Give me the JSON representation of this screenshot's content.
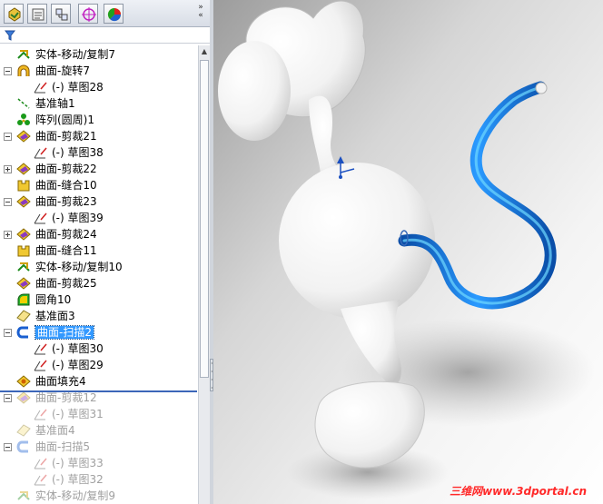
{
  "toolbar": {
    "buttons": [
      "feature-manager-icon",
      "property-manager-icon",
      "configuration-manager-icon",
      "dimxpert-icon",
      "display-manager-icon"
    ]
  },
  "tree": {
    "items": [
      {
        "label": "实体-移动/复制7",
        "icon": "move-copy-icon",
        "indent": 1,
        "expander": "none",
        "state": "normal"
      },
      {
        "label": "曲面-旋转7",
        "icon": "surface-revolve-icon",
        "indent": 1,
        "expander": "minus",
        "state": "normal"
      },
      {
        "label": "(-) 草图28",
        "icon": "sketch-icon",
        "indent": 2,
        "expander": "none",
        "state": "normal"
      },
      {
        "label": "基准轴1",
        "icon": "axis-icon",
        "indent": 1,
        "expander": "none",
        "state": "normal"
      },
      {
        "label": "阵列(圆周)1",
        "icon": "circular-pattern-icon",
        "indent": 1,
        "expander": "none",
        "state": "normal"
      },
      {
        "label": "曲面-剪裁21",
        "icon": "surface-trim-icon",
        "indent": 1,
        "expander": "minus",
        "state": "normal"
      },
      {
        "label": "(-) 草图38",
        "icon": "sketch-icon",
        "indent": 2,
        "expander": "none",
        "state": "normal"
      },
      {
        "label": "曲面-剪裁22",
        "icon": "surface-trim-icon",
        "indent": 1,
        "expander": "plus",
        "state": "normal"
      },
      {
        "label": "曲面-缝合10",
        "icon": "surface-knit-icon",
        "indent": 1,
        "expander": "none",
        "state": "normal"
      },
      {
        "label": "曲面-剪裁23",
        "icon": "surface-trim-icon",
        "indent": 1,
        "expander": "minus",
        "state": "normal"
      },
      {
        "label": "(-) 草图39",
        "icon": "sketch-icon",
        "indent": 2,
        "expander": "none",
        "state": "normal"
      },
      {
        "label": "曲面-剪裁24",
        "icon": "surface-trim-icon",
        "indent": 1,
        "expander": "plus",
        "state": "normal"
      },
      {
        "label": "曲面-缝合11",
        "icon": "surface-knit-icon",
        "indent": 1,
        "expander": "none",
        "state": "normal"
      },
      {
        "label": "实体-移动/复制10",
        "icon": "move-copy-icon",
        "indent": 1,
        "expander": "none",
        "state": "normal"
      },
      {
        "label": "曲面-剪裁25",
        "icon": "surface-trim-icon",
        "indent": 1,
        "expander": "none",
        "state": "normal"
      },
      {
        "label": "圆角10",
        "icon": "fillet-icon",
        "indent": 1,
        "expander": "none",
        "state": "normal"
      },
      {
        "label": "基准面3",
        "icon": "plane-icon",
        "indent": 1,
        "expander": "none",
        "state": "normal"
      },
      {
        "label": "曲面-扫描2",
        "icon": "surface-sweep-icon",
        "indent": 1,
        "expander": "minus",
        "state": "selected"
      },
      {
        "label": "(-) 草图30",
        "icon": "sketch-icon",
        "indent": 2,
        "expander": "none",
        "state": "normal"
      },
      {
        "label": "(-) 草图29",
        "icon": "sketch-icon",
        "indent": 2,
        "expander": "none",
        "state": "normal"
      },
      {
        "label": "曲面填充4",
        "icon": "surface-fill-icon",
        "indent": 1,
        "expander": "none",
        "state": "normal"
      },
      {
        "label": "曲面-剪裁12",
        "icon": "surface-trim-icon",
        "indent": 1,
        "expander": "minus",
        "state": "suppressed"
      },
      {
        "label": "(-) 草图31",
        "icon": "sketch-icon",
        "indent": 2,
        "expander": "none",
        "state": "suppressed"
      },
      {
        "label": "基准面4",
        "icon": "plane-icon",
        "indent": 1,
        "expander": "none",
        "state": "suppressed"
      },
      {
        "label": "曲面-扫描5",
        "icon": "surface-sweep-icon",
        "indent": 1,
        "expander": "minus",
        "state": "suppressed"
      },
      {
        "label": "(-) 草图33",
        "icon": "sketch-icon",
        "indent": 2,
        "expander": "none",
        "state": "suppressed"
      },
      {
        "label": "(-) 草图32",
        "icon": "sketch-icon",
        "indent": 2,
        "expander": "none",
        "state": "suppressed"
      },
      {
        "label": "实体-移动/复制9",
        "icon": "move-copy-icon",
        "indent": 1,
        "expander": "none",
        "state": "suppressed"
      }
    ]
  },
  "viewport": {
    "watermark": "三维网www.3dportal.cn",
    "accent_color": "#1e78d8",
    "model_description_icon": "monkey-model"
  }
}
